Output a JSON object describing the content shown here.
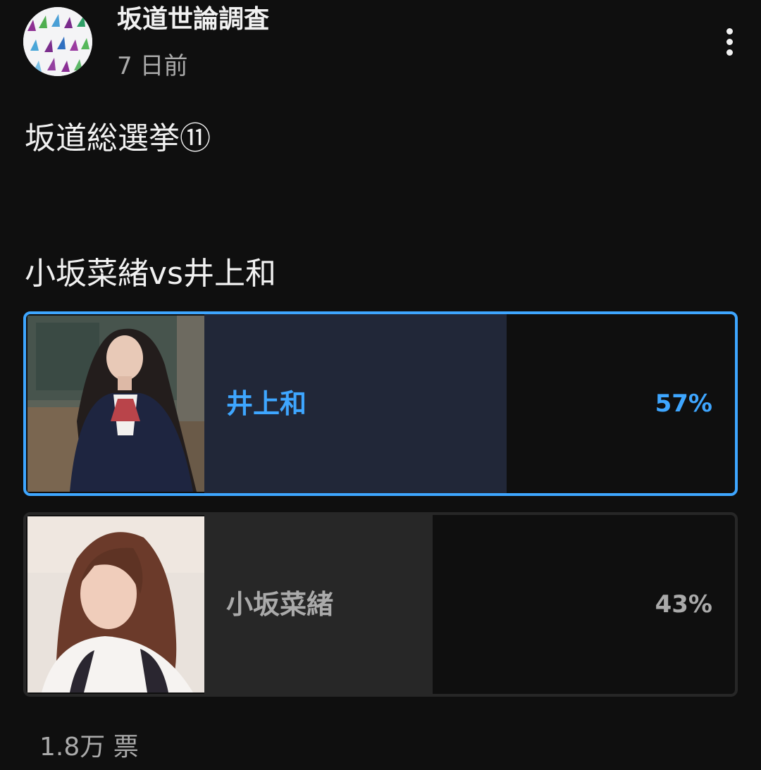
{
  "post": {
    "channel_name": "坂道世論調査",
    "time_ago": "7 日前",
    "title": "坂道総選挙⑪",
    "more_icon": "more-vertical-icon"
  },
  "poll": {
    "question": "小坂菜緒vs井上和",
    "options": [
      {
        "label": "井上和",
        "percent_text": "57%",
        "percent": 57,
        "selected": true
      },
      {
        "label": "小坂菜緒",
        "percent_text": "43%",
        "percent": 43,
        "selected": false
      }
    ],
    "total_votes": "1.8万 票"
  },
  "colors": {
    "background": "#0f0f0f",
    "accent": "#3ea6ff",
    "selected_fill": "#212738",
    "unselected_fill": "#272727",
    "secondary_text": "#aaaaaa"
  }
}
